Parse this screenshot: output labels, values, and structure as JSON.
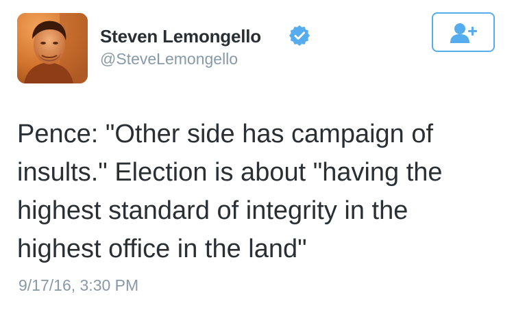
{
  "author": {
    "display_name": "Steven Lemongello",
    "handle": "@SteveLemongello",
    "verified": true,
    "avatar": "profile-photo"
  },
  "follow_button": {
    "icon": "follow-user-icon",
    "color": "#55acee"
  },
  "tweet": {
    "lines": [
      "Pence: \"Other side has campaign of",
      "insults.\" Election is about \"having the",
      "highest standard of integrity in the",
      "highest office in the land\""
    ],
    "timestamp": "9/17/16, 3:30 PM"
  },
  "colors": {
    "text": "#292f33",
    "secondary": "#8899a6",
    "accent": "#55acee",
    "background": "#ffffff"
  }
}
